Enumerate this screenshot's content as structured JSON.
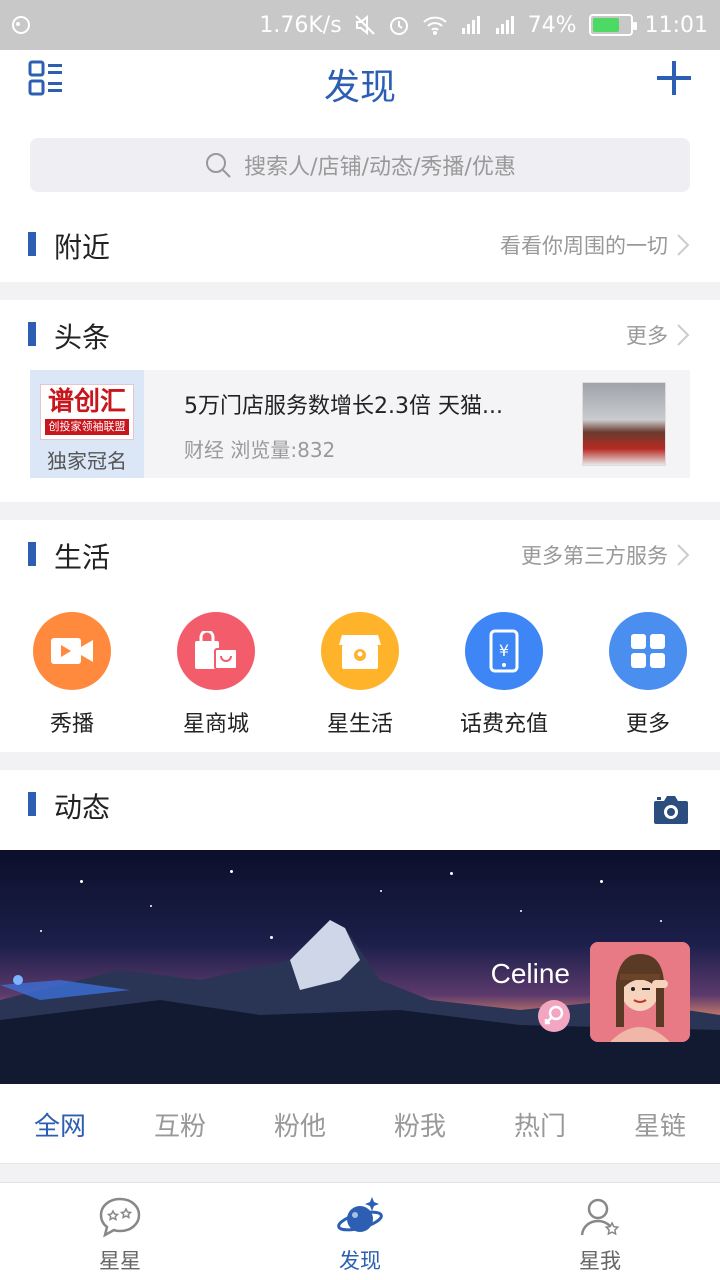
{
  "status_bar": {
    "speed": "1.76K/s",
    "battery": "74%",
    "time": "11:01",
    "battery_level": 0.74
  },
  "header": {
    "title": "发现"
  },
  "search": {
    "placeholder": "搜索人/店铺/动态/秀播/优惠"
  },
  "nearby": {
    "title": "附近",
    "more": "看看你周围的一切"
  },
  "headlines": {
    "title": "头条",
    "more": "更多",
    "sponsor_logo": "谱创汇",
    "sponsor_logo_sub": "创投家领袖联盟",
    "sponsor_caption": "独家冠名",
    "headline": "5万门店服务数增长2.3倍 天猫...",
    "meta": "财经 浏览量:832"
  },
  "life": {
    "title": "生活",
    "more": "更多第三方服务",
    "items": [
      {
        "label": "秀播",
        "icon": "video-icon",
        "color": "#ff8a3d"
      },
      {
        "label": "星商城",
        "icon": "shopping-bag-icon",
        "color": "#f25c6b"
      },
      {
        "label": "星生活",
        "icon": "store-icon",
        "color": "#ffb32b"
      },
      {
        "label": "话费充值",
        "icon": "phone-recharge-icon",
        "color": "#3e86f5"
      },
      {
        "label": "更多",
        "icon": "grid-icon",
        "color": "#4a8ef0"
      }
    ]
  },
  "feed": {
    "title": "动态",
    "username": "Celine"
  },
  "tabs": [
    "全网",
    "互粉",
    "粉他",
    "粉我",
    "热门",
    "星链"
  ],
  "bottom_nav": [
    {
      "label": "星星",
      "icon": "chat-bubble-icon"
    },
    {
      "label": "发现",
      "icon": "planet-icon"
    },
    {
      "label": "星我",
      "icon": "user-icon"
    }
  ],
  "colors": {
    "brand": "#2c5fb3"
  }
}
